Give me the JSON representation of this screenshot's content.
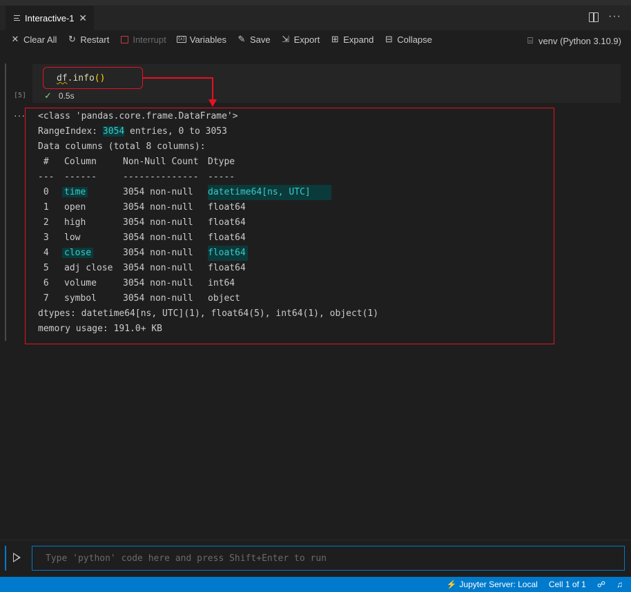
{
  "tab": {
    "title": "Interactive-1",
    "close": "✕"
  },
  "toolbar": {
    "clear_all": "Clear All",
    "restart": "Restart",
    "interrupt": "Interrupt",
    "variables": "Variables",
    "save": "Save",
    "export": "Export",
    "expand": "Expand",
    "collapse": "Collapse",
    "kernel": "venv (Python 3.10.9)"
  },
  "cell": {
    "execution_count": "[5]",
    "code_df": "df",
    "code_dot": ".",
    "code_fn": "info",
    "code_parens": "()",
    "duration": "0.5s"
  },
  "output": {
    "class_line": "<class 'pandas.core.frame.DataFrame'>",
    "range_prefix": "RangeIndex: ",
    "range_entries": "3054",
    "range_suffix": " entries, 0 to 3053",
    "data_columns": "Data columns (total 8 columns):",
    "header": {
      "idx": " #",
      "column": "Column",
      "non_null": "Non-Null Count",
      "dtype": "Dtype"
    },
    "separator": {
      "idx": "---",
      "column": "------",
      "non_null": "--------------",
      "dtype": "-----"
    },
    "rows": [
      {
        "idx": " 0",
        "column": "time",
        "non_null": "3054 non-null",
        "dtype": "datetime64[ns, UTC]"
      },
      {
        "idx": " 1",
        "column": "open",
        "non_null": "3054 non-null",
        "dtype": "float64"
      },
      {
        "idx": " 2",
        "column": "high",
        "non_null": "3054 non-null",
        "dtype": "float64"
      },
      {
        "idx": " 3",
        "column": "low",
        "non_null": "3054 non-null",
        "dtype": "float64"
      },
      {
        "idx": " 4",
        "column": "close",
        "non_null": "3054 non-null",
        "dtype": "float64"
      },
      {
        "idx": " 5",
        "column": "adj close",
        "non_null": "3054 non-null",
        "dtype": "float64"
      },
      {
        "idx": " 6",
        "column": "volume",
        "non_null": "3054 non-null",
        "dtype": "int64"
      },
      {
        "idx": " 7",
        "column": "symbol",
        "non_null": "3054 non-null",
        "dtype": "object"
      }
    ],
    "dtypes": "dtypes: datetime64[ns, UTC](1), float64(5), int64(1), object(1)",
    "memory": "memory usage: 191.0+ KB"
  },
  "console": {
    "placeholder": "Type 'python' code here and press Shift+Enter to run"
  },
  "statusbar": {
    "jupyter_server": "Jupyter Server: Local",
    "cell_position": "Cell 1 of 1"
  },
  "colors": {
    "accent": "#007acc",
    "annotation": "#e81123",
    "highlight_text": "#3dc9c9",
    "highlight_bg": "#0b3a3a"
  }
}
